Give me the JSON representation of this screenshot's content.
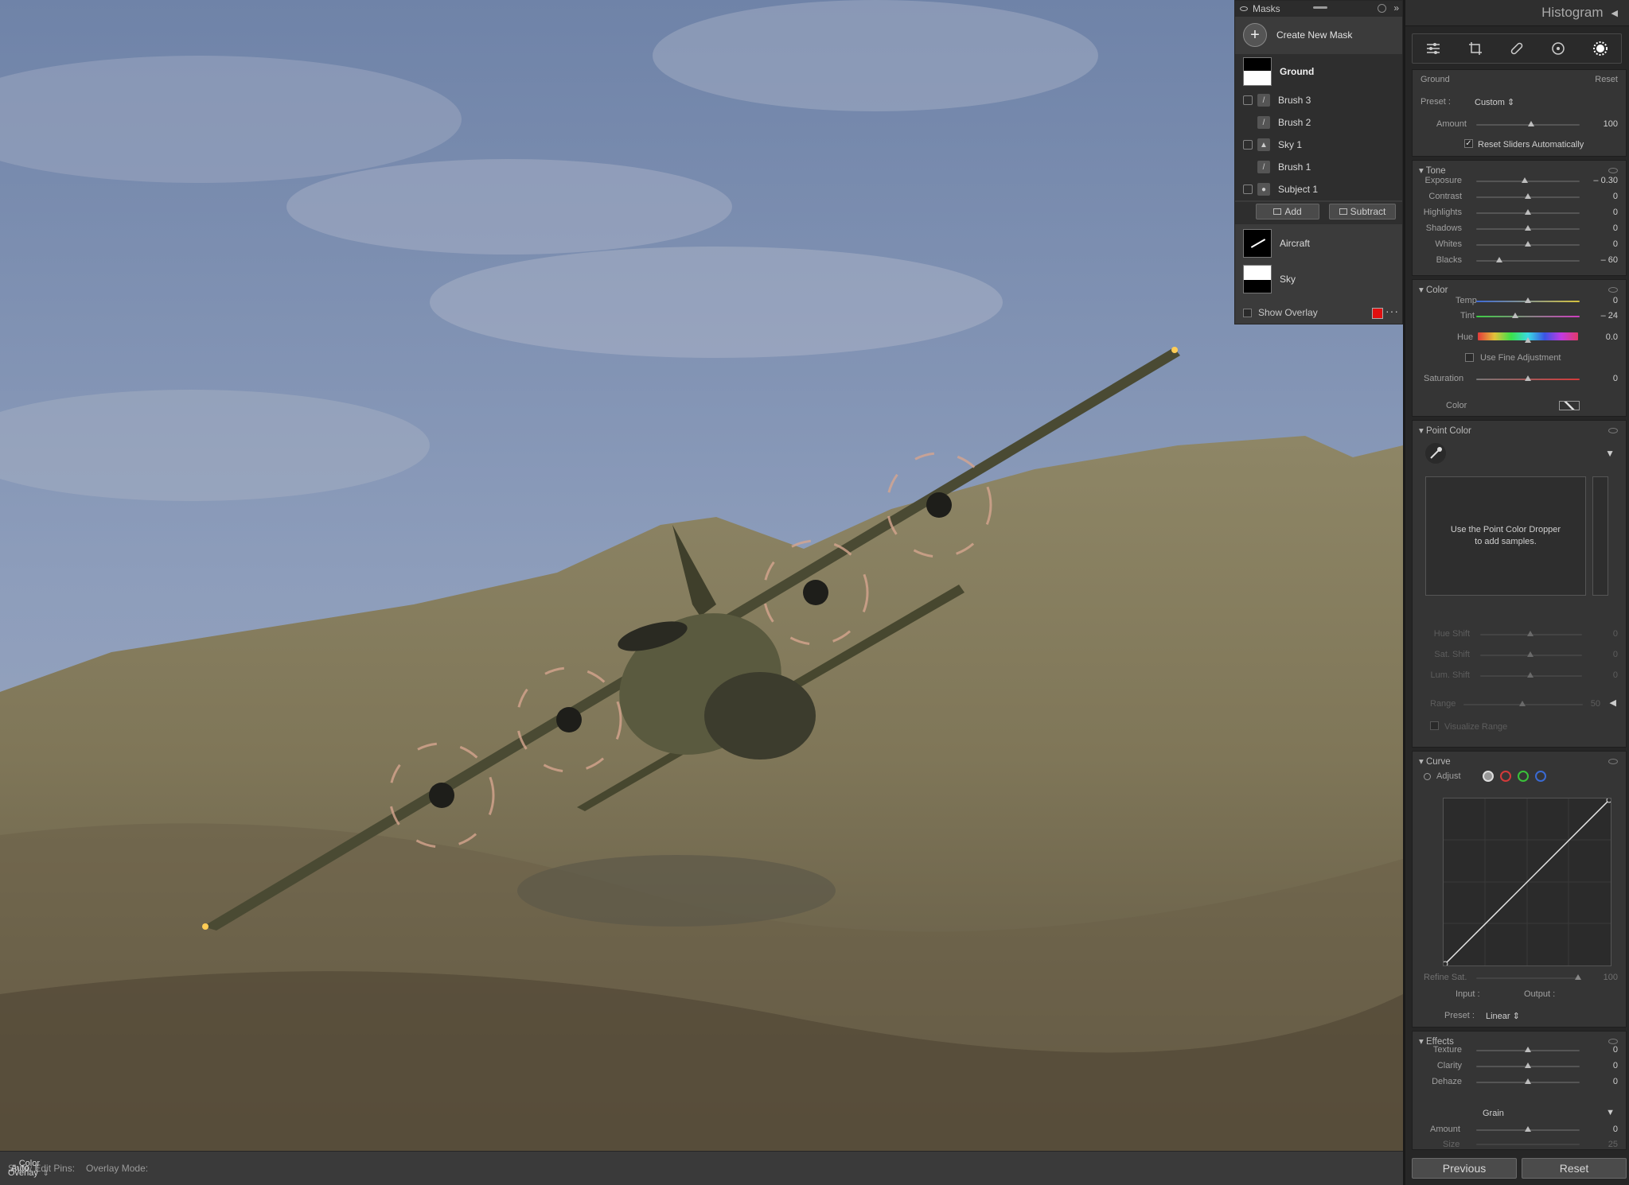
{
  "masks_panel": {
    "title": "Masks",
    "create_label": "Create New Mask",
    "mask_ground": "Ground",
    "components": [
      "Brush 3",
      "Brush 2",
      "Sky 1",
      "Brush 1",
      "Subject 1"
    ],
    "add_label": "Add",
    "subtract_label": "Subtract",
    "mask_aircraft": "Aircraft",
    "mask_sky": "Sky",
    "show_overlay": "Show Overlay",
    "overlay_color": "#e01010"
  },
  "bottom_bar": {
    "edit_pins_label": "Show Edit Pins:",
    "edit_pins_value": "Auto",
    "overlay_label": "Overlay Mode:",
    "overlay_value": "Color Overlay"
  },
  "panel": {
    "histogram": "Histogram",
    "mask_name": "Ground",
    "reset_label": "Reset",
    "preset_label": "Preset :",
    "preset_value": "Custom",
    "amount_label": "Amount",
    "amount_value": "100",
    "reset_sliders": "Reset Sliders Automatically",
    "tone": {
      "title": "Tone",
      "rows": [
        {
          "label": "Exposure",
          "value": "– 0.30",
          "pos": 0.47
        },
        {
          "label": "Contrast",
          "value": "0",
          "pos": 0.5
        },
        {
          "label": "Highlights",
          "value": "0",
          "pos": 0.5
        },
        {
          "label": "Shadows",
          "value": "0",
          "pos": 0.5
        },
        {
          "label": "Whites",
          "value": "0",
          "pos": 0.5
        },
        {
          "label": "Blacks",
          "value": "– 60",
          "pos": 0.22
        }
      ]
    },
    "color": {
      "title": "Color",
      "temp_label": "Temp",
      "temp_value": "0",
      "tint_label": "Tint",
      "tint_value": "– 24",
      "hue_label": "Hue",
      "hue_value": "0.0",
      "fine_label": "Use Fine Adjustment",
      "saturation_label": "Saturation",
      "saturation_value": "0",
      "color_label": "Color"
    },
    "point_color": {
      "title": "Point Color",
      "hint1": "Use the Point Color Dropper",
      "hint2": "to add samples.",
      "hue_shift": "Hue Shift",
      "hue_shift_value": "0",
      "sat_shift": "Sat. Shift",
      "sat_shift_value": "0",
      "lum_shift": "Lum. Shift",
      "lum_shift_value": "0",
      "range": "Range",
      "range_value": "50",
      "visualize": "Visualize Range"
    },
    "curve": {
      "title": "Curve",
      "adjust": "Adjust",
      "refine_label": "Refine Sat.",
      "refine_value": "100",
      "input_label": "Input :",
      "output_label": "Output :",
      "preset_label": "Preset :",
      "preset_value": "Linear"
    },
    "effects": {
      "title": "Effects",
      "rows": [
        {
          "label": "Texture",
          "value": "0"
        },
        {
          "label": "Clarity",
          "value": "0"
        },
        {
          "label": "Dehaze",
          "value": "0"
        }
      ],
      "grain": "Grain",
      "grain_amount": "Amount",
      "grain_amount_value": "0",
      "grain_size": "Size",
      "grain_size_value": "25"
    },
    "previous": "Previous",
    "reset_button": "Reset"
  }
}
